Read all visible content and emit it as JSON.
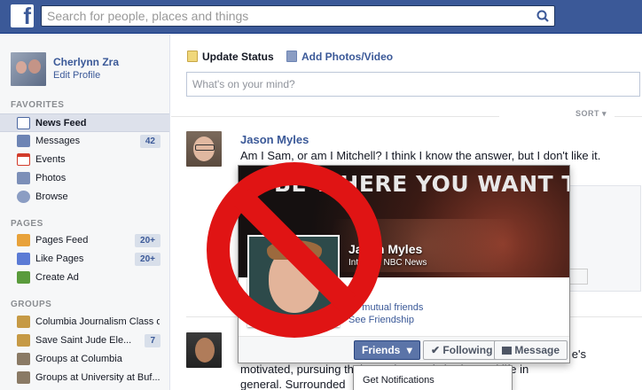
{
  "topbar": {
    "logo": "f",
    "search_placeholder": "Search for people, places and things"
  },
  "sidebar": {
    "profile": {
      "name": "Cherlynn Zra",
      "edit": "Edit Profile"
    },
    "favorites_heading": "FAVORITES",
    "favorites": [
      {
        "label": "News Feed",
        "icon": "news-feed-icon",
        "color": "#4b67a1"
      },
      {
        "label": "Messages",
        "icon": "messages-icon",
        "count": "42",
        "color": "#6d84b4"
      },
      {
        "label": "Events",
        "icon": "events-icon",
        "color": "#d23b2a"
      },
      {
        "label": "Photos",
        "icon": "photos-icon",
        "color": "#7c8fb8"
      },
      {
        "label": "Browse",
        "icon": "browse-icon",
        "color": "#8b9dc3"
      }
    ],
    "pages_heading": "PAGES",
    "pages": [
      {
        "label": "Pages Feed",
        "icon": "pages-feed-icon",
        "count": "20+",
        "color": "#e8a23a"
      },
      {
        "label": "Like Pages",
        "icon": "like-pages-icon",
        "count": "20+",
        "color": "#5b7bd5"
      },
      {
        "label": "Create Ad",
        "icon": "create-ad-icon",
        "color": "#5a9b3c"
      }
    ],
    "groups_heading": "GROUPS",
    "groups": [
      {
        "label": "Columbia Journalism Class o...",
        "icon": "group-icon",
        "color": "#c69a45"
      },
      {
        "label": "Save Saint Jude Ele...",
        "icon": "group-icon",
        "count": "7",
        "color": "#c69a45"
      },
      {
        "label": "Groups at Columbia",
        "icon": "group-icon",
        "color": "#8a7a65"
      },
      {
        "label": "Groups at University at Buf...",
        "icon": "group-icon",
        "color": "#8a7a65"
      }
    ]
  },
  "composer": {
    "update_status": "Update Status",
    "add_photos": "Add Photos/Video",
    "placeholder": "What's on your mind?"
  },
  "feed": {
    "sort": "SORT",
    "story1": {
      "author": "Jason Myles",
      "text": "Am I Sam, or am I Mitchell? I think I know the answer, but I don't like it."
    },
    "story2": {
      "text_line1": "e's",
      "text_line2": "motivated, pursuing their passion, and sharing and life in",
      "text_line3": "general. Surrounded"
    }
  },
  "hovercard": {
    "cover_slogan": "BE WHERE YOU WANT TO BE",
    "name": "Jason Myles",
    "subtitle": "Intern at NBC News",
    "mutual_friends": "16 mutual friends",
    "friendship": "See Friendship",
    "friends_button": "Friends",
    "following_button": "Following",
    "message_button": "Message"
  },
  "dropdown": {
    "item": "Get Notifications"
  },
  "overlay": {
    "icon": "prohibited-icon",
    "color": "#e01414"
  }
}
